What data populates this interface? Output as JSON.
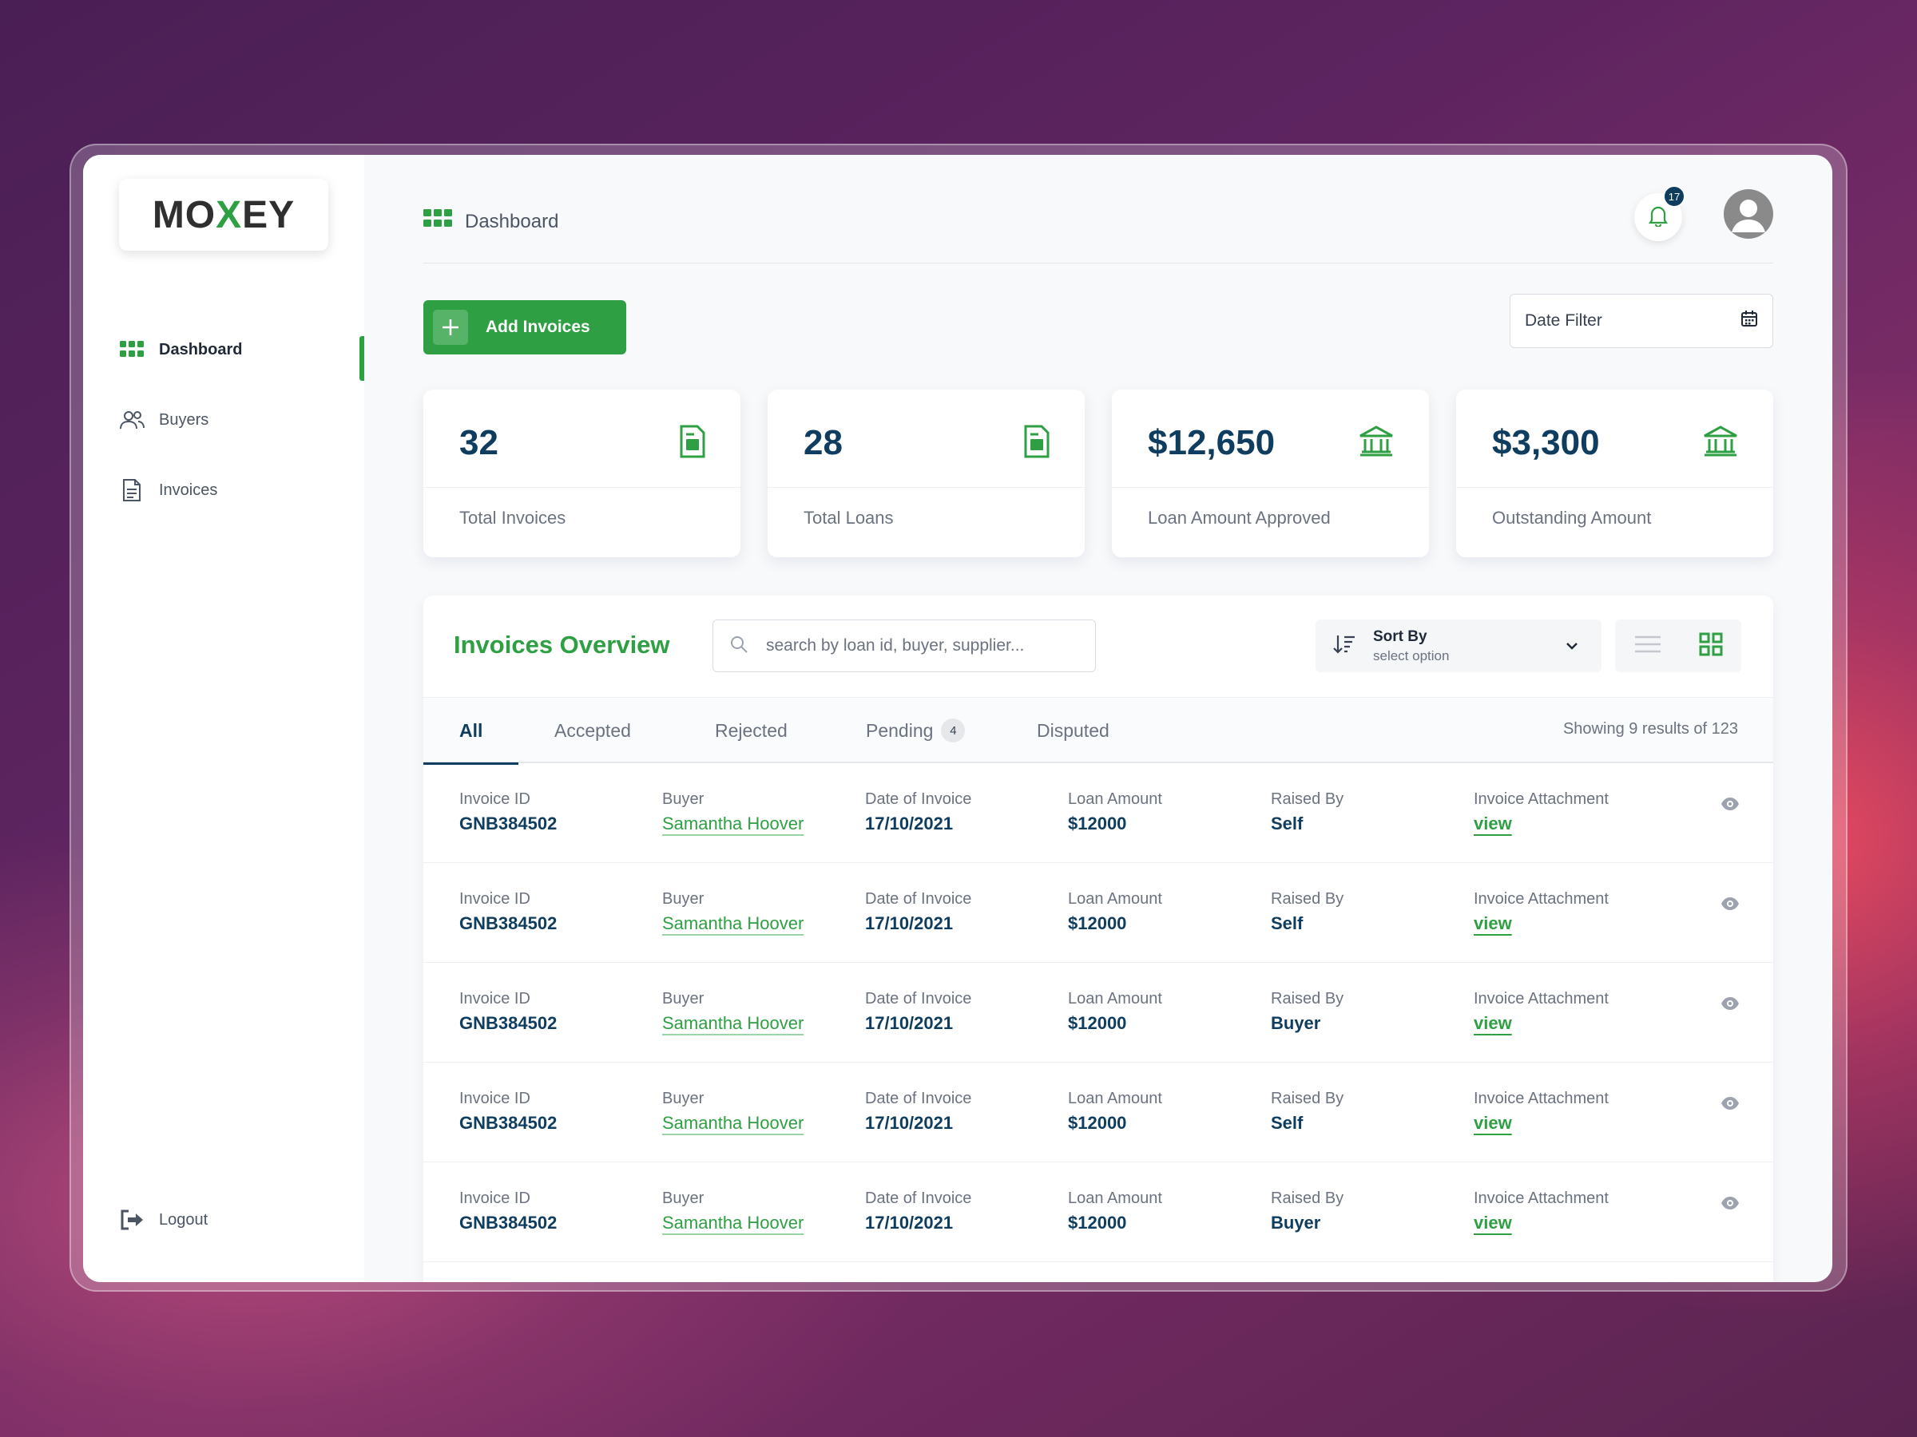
{
  "app": {
    "logo_pre": "MO",
    "logo_x": "X",
    "logo_post": "EY"
  },
  "sidebar": {
    "items": [
      {
        "label": "Dashboard",
        "icon": "grid-icon",
        "active": true
      },
      {
        "label": "Buyers",
        "icon": "users-icon",
        "active": false
      },
      {
        "label": "Invoices",
        "icon": "document-icon",
        "active": false
      }
    ],
    "logout_label": "Logout"
  },
  "header": {
    "breadcrumb": "Dashboard",
    "notification_count": "17"
  },
  "actions": {
    "add_invoices_label": "Add Invoices",
    "date_filter_label": "Date Filter"
  },
  "stats": [
    {
      "value": "32",
      "label": "Total Invoices",
      "icon": "document-icon"
    },
    {
      "value": "28",
      "label": "Total Loans",
      "icon": "document-icon"
    },
    {
      "value": "$12,650",
      "label": "Loan Amount Approved",
      "icon": "bank-icon"
    },
    {
      "value": "$3,300",
      "label": "Outstanding Amount",
      "icon": "bank-icon"
    }
  ],
  "overview": {
    "title": "Invoices Overview",
    "search_placeholder": "search by loan id, buyer, supplier...",
    "sort_label": "Sort By",
    "sort_value": "select option",
    "tabs": [
      {
        "label": "All",
        "active": true
      },
      {
        "label": "Accepted"
      },
      {
        "label": "Rejected"
      },
      {
        "label": "Pending",
        "count": "4"
      },
      {
        "label": "Disputed"
      }
    ],
    "showing": "Showing 9 results of 123",
    "columns": [
      "Invoice ID",
      "Buyer",
      "Date of Invoice",
      "Loan Amount",
      "Raised By",
      "Invoice Attachment"
    ],
    "rows": [
      {
        "invoice_id": "GNB384502",
        "buyer": "Samantha Hoover",
        "date": "17/10/2021",
        "amount": "$12000",
        "raised_by": "Self",
        "attachment": "view"
      },
      {
        "invoice_id": "GNB384502",
        "buyer": "Samantha Hoover",
        "date": "17/10/2021",
        "amount": "$12000",
        "raised_by": "Self",
        "attachment": "view"
      },
      {
        "invoice_id": "GNB384502",
        "buyer": "Samantha Hoover",
        "date": "17/10/2021",
        "amount": "$12000",
        "raised_by": "Buyer",
        "attachment": "view"
      },
      {
        "invoice_id": "GNB384502",
        "buyer": "Samantha Hoover",
        "date": "17/10/2021",
        "amount": "$12000",
        "raised_by": "Self",
        "attachment": "view"
      },
      {
        "invoice_id": "GNB384502",
        "buyer": "Samantha Hoover",
        "date": "17/10/2021",
        "amount": "$12000",
        "raised_by": "Buyer",
        "attachment": "view"
      }
    ]
  },
  "colors": {
    "brand_green": "#2ea043",
    "navy": "#0f3d5f"
  }
}
